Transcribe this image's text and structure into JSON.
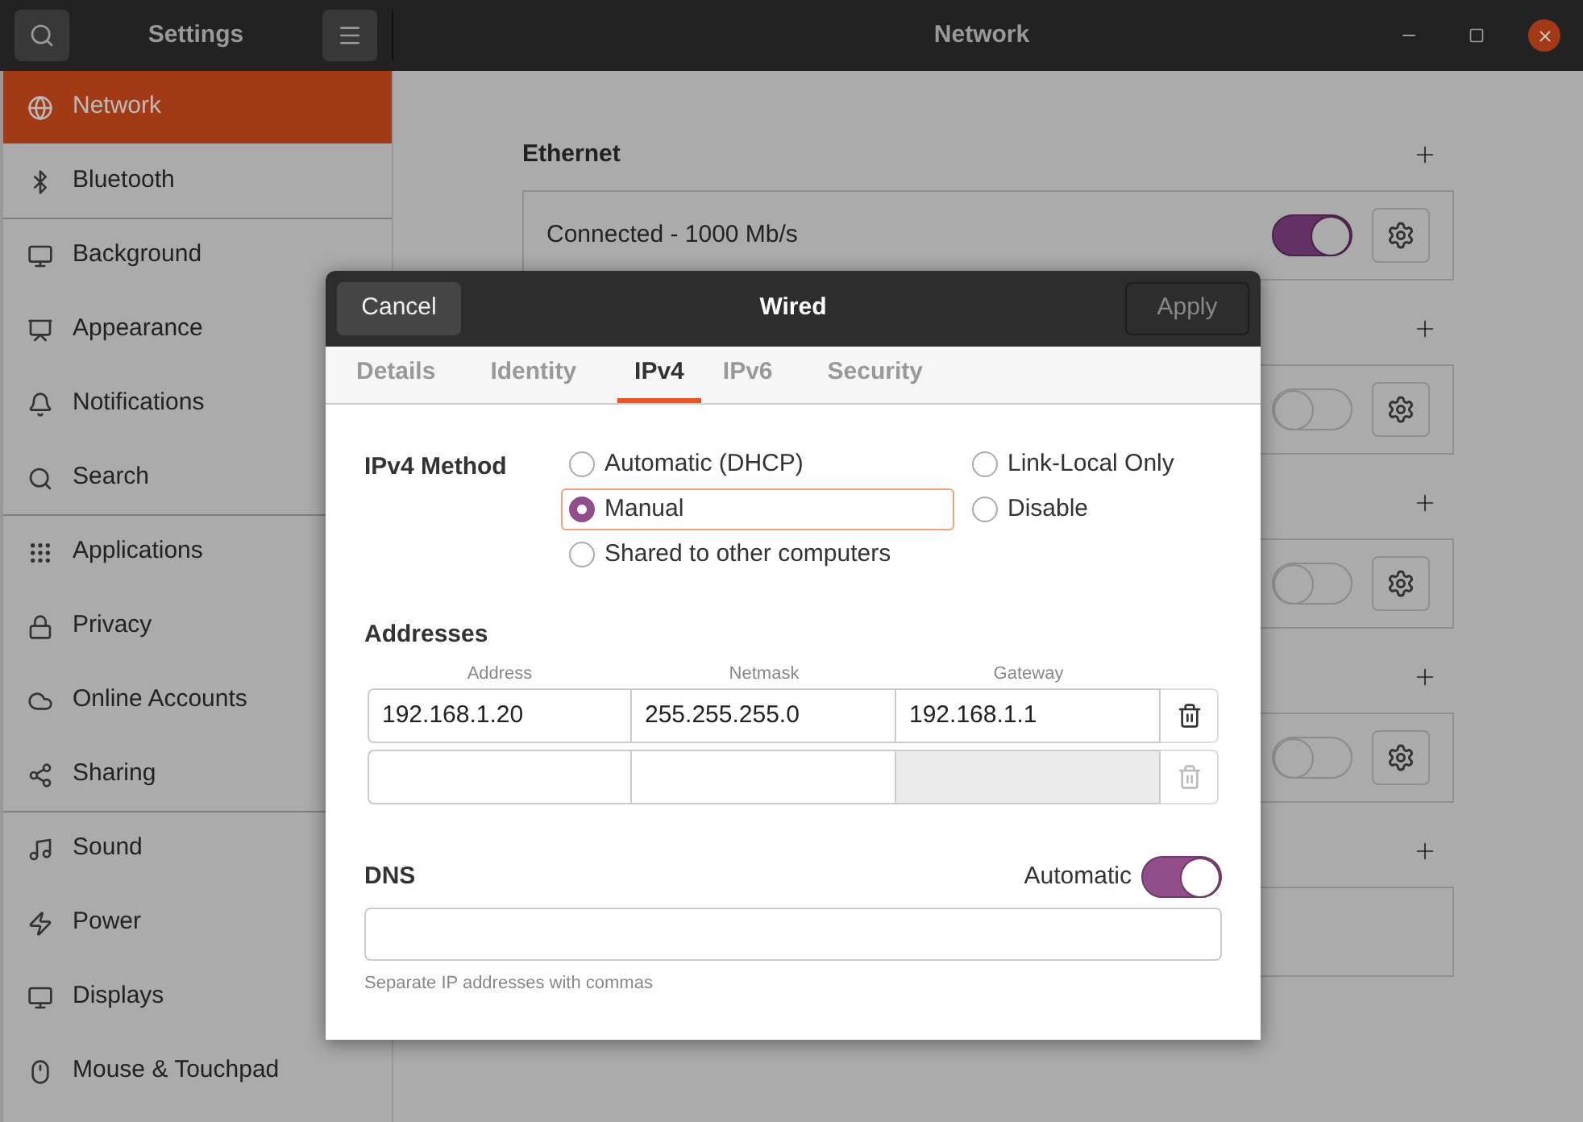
{
  "window": {
    "sidebar_title": "Settings",
    "title": "Network"
  },
  "sidebar": {
    "items": [
      {
        "label": "Network",
        "selected": true,
        "divider_after": false
      },
      {
        "label": "Bluetooth",
        "selected": false,
        "divider_after": true
      },
      {
        "label": "Background",
        "selected": false,
        "divider_after": false
      },
      {
        "label": "Appearance",
        "selected": false,
        "divider_after": false
      },
      {
        "label": "Notifications",
        "selected": false,
        "divider_after": false
      },
      {
        "label": "Search",
        "selected": false,
        "divider_after": true
      },
      {
        "label": "Applications",
        "selected": false,
        "divider_after": false
      },
      {
        "label": "Privacy",
        "selected": false,
        "divider_after": false
      },
      {
        "label": "Online Accounts",
        "selected": false,
        "divider_after": false
      },
      {
        "label": "Sharing",
        "selected": false,
        "divider_after": true
      },
      {
        "label": "Sound",
        "selected": false,
        "divider_after": false
      },
      {
        "label": "Power",
        "selected": false,
        "divider_after": false
      },
      {
        "label": "Displays",
        "selected": false,
        "divider_after": false
      },
      {
        "label": "Mouse & Touchpad",
        "selected": false,
        "divider_after": false
      }
    ]
  },
  "sections": [
    {
      "title": "Ethernet",
      "kind": "toggle",
      "label": "Connected - 1000 Mb/s",
      "on": true
    },
    {
      "kind": "toggle",
      "on": false
    },
    {
      "kind": "toggle",
      "on": false
    },
    {
      "kind": "toggle",
      "on": false
    },
    {
      "kind": "empty"
    }
  ],
  "dialog": {
    "title": "Wired",
    "cancel": "Cancel",
    "apply": {
      "label": "Apply",
      "disabled": true
    },
    "tabs": [
      {
        "label": "Details",
        "selected": false
      },
      {
        "label": "Identity",
        "selected": false
      },
      {
        "label": "IPv4",
        "selected": true
      },
      {
        "label": "IPv6",
        "selected": false
      },
      {
        "label": "Security",
        "selected": false
      }
    ],
    "method": {
      "label": "IPv4 Method",
      "options": [
        {
          "label": "Automatic (DHCP)",
          "selected": false
        },
        {
          "label": "Link-Local Only",
          "selected": false
        },
        {
          "label": "Manual",
          "selected": true
        },
        {
          "label": "Disable",
          "selected": false
        },
        {
          "label": "Shared to other computers",
          "selected": false
        }
      ]
    },
    "addresses": {
      "title": "Addresses",
      "columns": [
        "Address",
        "Netmask",
        "Gateway"
      ],
      "rows": [
        {
          "address": "192.168.1.20",
          "netmask": "255.255.255.0",
          "gateway": "192.168.1.1",
          "gateway_disabled": false,
          "delete_disabled": false
        },
        {
          "gateway_disabled": true,
          "delete_disabled": true
        }
      ]
    },
    "dns": {
      "title": "DNS",
      "automatic_label": "Automatic",
      "automatic_on": true,
      "hint": "Separate IP addresses with commas"
    }
  }
}
